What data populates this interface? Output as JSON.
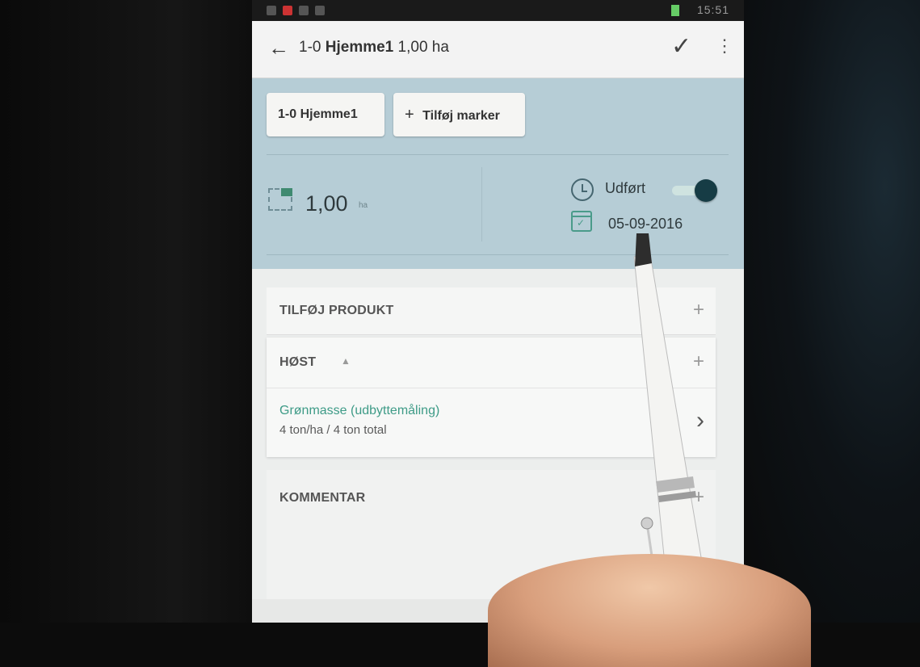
{
  "status_bar": {
    "time": "15:51"
  },
  "app_bar": {
    "back_icon": "arrow-back-icon",
    "field_id": "1-0",
    "field_name": "Hjemme1",
    "field_area": "1,00 ha",
    "confirm_icon": "check-icon",
    "menu_icon": "more-vert-icon"
  },
  "chips": {
    "field_chip": "1-0 Hjemme1",
    "add_chip_plus": "+",
    "add_chip_label": "Tilføj marker"
  },
  "summary": {
    "area_value": "1,00",
    "area_unit": "ha",
    "status_label": "Udført",
    "status_done": true,
    "date": "05-09-2016"
  },
  "add_product": {
    "label": "TILFØJ PRODUKT",
    "plus": "+"
  },
  "harvest": {
    "label": "HØST",
    "collapse_arrow": "▲",
    "plus": "+",
    "product_name": "Grønmasse (udbyttemåling)",
    "product_amount": "4 ton/ha  /  4 ton total",
    "chevron": "›"
  },
  "comment": {
    "label": "KOMMENTAR",
    "plus": "+"
  },
  "colors": {
    "header_bg": "#b6cdd6",
    "accent_green": "#3e9b87",
    "toggle_knob": "#163c45"
  }
}
